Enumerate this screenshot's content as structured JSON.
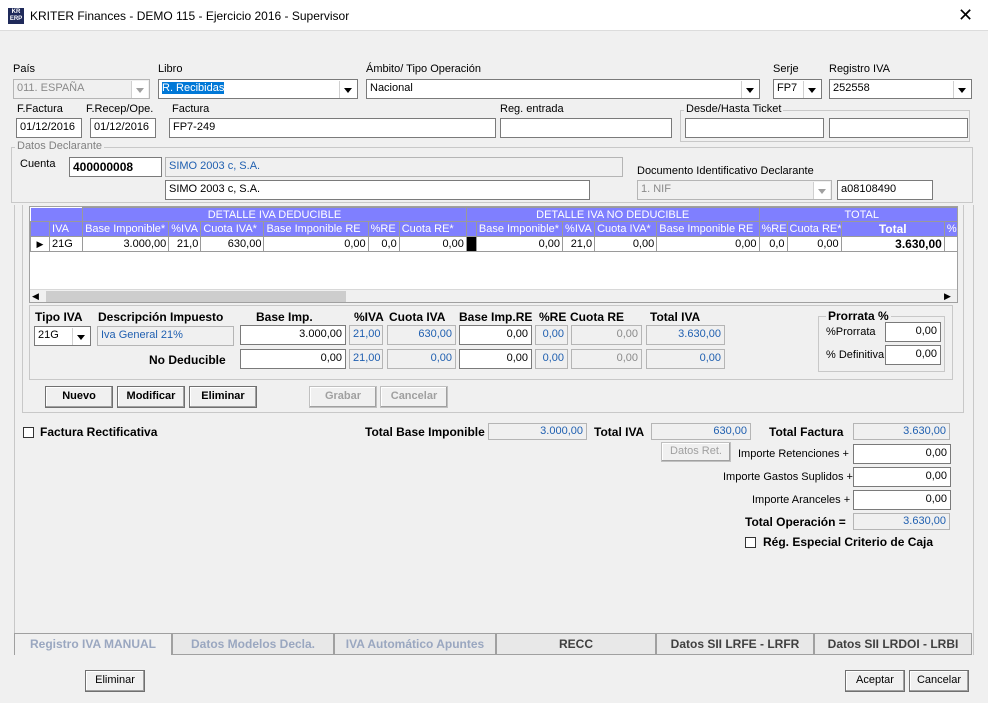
{
  "window": {
    "title": "KRITER Finances - DEMO 115 - Ejercicio 2016 - Supervisor",
    "icon_text": "KR ERP"
  },
  "header": {
    "pais_label": "País",
    "pais_value": "011. ESPAÑA",
    "libro_label": "Libro",
    "libro_value": "R. Recibidas",
    "ambito_label": "Ámbito/ Tipo Operación",
    "ambito_value": "Nacional",
    "serie_label": "Serje",
    "serie_value": "FP7",
    "registro_label": "Registro IVA",
    "registro_value": "252558",
    "ffactura_label": "F.Factura",
    "ffactura_value": "01/12/2016",
    "frecep_label": "F.Recep/Ope.",
    "frecep_value": "01/12/2016",
    "factura_label": "Factura",
    "factura_value": "FP7-249",
    "regentrada_label": "Reg. entrada",
    "regentrada_value": "",
    "ticket_label": "Desde/Hasta Ticket"
  },
  "declarante": {
    "group_title": "Datos Declarante",
    "cuenta_label": "Cuenta",
    "cuenta_value": "400000008",
    "cuenta_name": "SIMO 2003 c, S.A.",
    "name_value": "SIMO 2003 c, S.A.",
    "doc_label": "Documento Identificativo Declarante",
    "doc_type": "1. NIF",
    "doc_value": "a08108490"
  },
  "grid": {
    "group_headers": [
      "DETALLE IVA DEDUCIBLE",
      "DETALLE IVA NO DEDUCIBLE",
      "TOTAL"
    ],
    "columns": [
      "IVA",
      "Base Imponible*",
      "%IVA",
      "Cuota IVA*",
      "Base Imponible RE",
      "%RE",
      "Cuota RE*",
      "Base Imponible*",
      "%IVA",
      "Cuota IVA*",
      "Base Imponible RE",
      "%RE",
      "Cuota RE*",
      "Total",
      "%F"
    ],
    "rows": [
      [
        "21G",
        "3.000,00",
        "21,0",
        "630,00",
        "0,00",
        "0,0",
        "0,00",
        "0,00",
        "21,0",
        "0,00",
        "0,00",
        "0,0",
        "0,00",
        "3.630,00",
        ""
      ]
    ]
  },
  "detail": {
    "tipo_iva_label": "Tipo IVA",
    "tipo_iva_value": "21G",
    "desc_label": "Descripción Impuesto",
    "desc_value": "Iva General 21%",
    "base_label": "Base Imp.",
    "piva_label": "%IVA",
    "cuota_label": "Cuota IVA",
    "basere_label": "Base Imp.RE",
    "pre_label": "%RE",
    "cuotare_label": "Cuota RE",
    "totaliva_label": "Total IVA",
    "row1": {
      "base": "3.000,00",
      "piva": "21,00",
      "cuota": "630,00",
      "basere": "0,00",
      "pre": "0,00",
      "cuotare": "0,00",
      "total": "3.630,00"
    },
    "nodeducible_label": "No  Deducible",
    "row2": {
      "base": "0,00",
      "piva": "21,00",
      "cuota": "0,00",
      "basere": "0,00",
      "pre": "0,00",
      "cuotare": "0,00",
      "total": "0,00"
    },
    "prorrata_title": "Prorrata %",
    "prorrata_label": "%Prorrata",
    "prorrata_value": "0,00",
    "definitiva_label": "% Definitiva",
    "definitiva_value": "0,00"
  },
  "actions": {
    "nuevo": "Nuevo",
    "modificar": "Modificar",
    "eliminar": "Eliminar",
    "grabar": "Grabar",
    "cancelar": "Cancelar"
  },
  "totals": {
    "rectificativa_label": "Factura Rectificativa",
    "total_base_label": "Total Base Imponible",
    "total_base_value": "3.000,00",
    "total_iva_label": "Total IVA",
    "total_iva_value": "630,00",
    "total_factura_label": "Total Factura",
    "total_factura_value": "3.630,00",
    "datos_ret": "Datos Ret.",
    "retenciones_label": "Importe Retenciones +",
    "retenciones_value": "0,00",
    "gastos_label": "Importe Gastos Suplidos +",
    "gastos_value": "0,00",
    "aranceles_label": "Importe Aranceles +",
    "aranceles_value": "0,00",
    "total_op_label": "Total Operación =",
    "total_op_value": "3.630,00",
    "criterio_caja_label": "Rég. Especial Criterio de Caja"
  },
  "tabs": [
    "Registro IVA MANUAL",
    "Datos Modelos Decla.",
    "IVA Automático Apuntes",
    "RECC",
    "Datos SII  LRFE - LRFR",
    "Datos SII LRDOI - LRBI"
  ],
  "footer": {
    "eliminar": "Eliminar",
    "aceptar": "Aceptar",
    "cancelar": "Cancelar"
  }
}
